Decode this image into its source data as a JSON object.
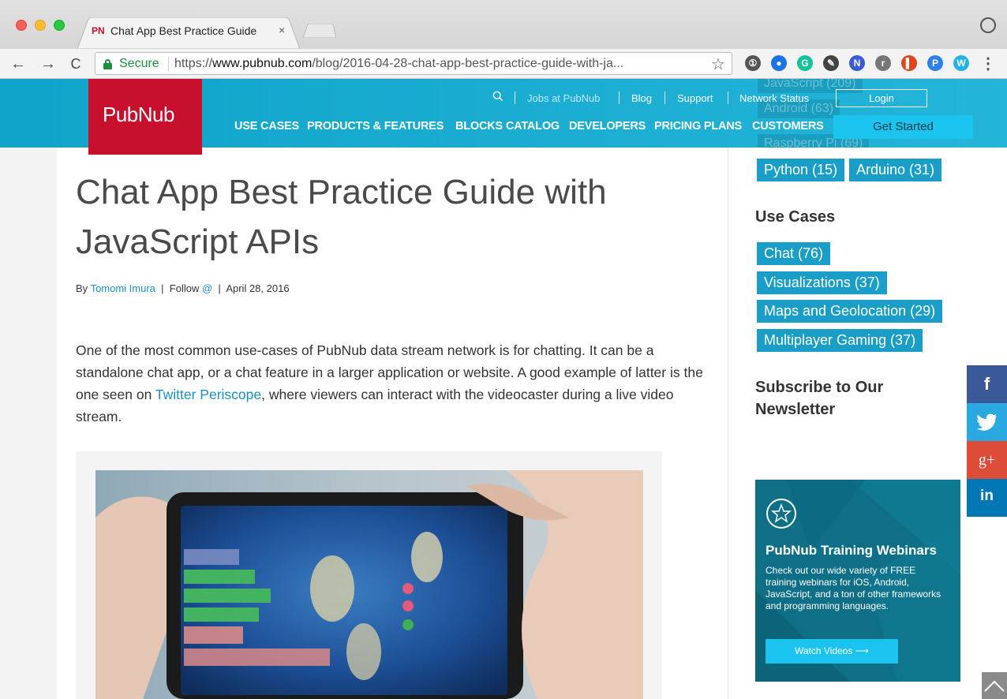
{
  "browser": {
    "tab_favicon": "PN",
    "tab_title": "Chat App Best Practice Guide",
    "tab_close": "×",
    "secure_label": "Secure",
    "url_scheme": "https://",
    "url_host": "www.pubnub.com",
    "url_path": "/blog/2016-04-28-chat-app-best-practice-guide-with-ja...",
    "nav_back": "←",
    "nav_forward": "→",
    "nav_reload": "C",
    "bookmark_star": "☆",
    "menu": "⋮",
    "extensions": [
      {
        "icon": "1password-icon",
        "glyph": "①",
        "color": "#555555"
      },
      {
        "icon": "meet-icon",
        "glyph": "●",
        "color": "#1a73e8"
      },
      {
        "icon": "grammarly-icon",
        "glyph": "G",
        "color": "#15c39a"
      },
      {
        "icon": "pixel-icon",
        "glyph": "✎",
        "color": "#444444"
      },
      {
        "icon": "notion-icon",
        "glyph": "N",
        "color": "#3b5bdb"
      },
      {
        "icon": "r-icon",
        "glyph": "r",
        "color": "#777777"
      },
      {
        "icon": "book-icon",
        "glyph": "▌",
        "color": "#e0441d"
      },
      {
        "icon": "pricetag-icon",
        "glyph": "P",
        "color": "#2f80ed"
      },
      {
        "icon": "w-icon",
        "glyph": "W",
        "color": "#24b3e6"
      }
    ]
  },
  "site": {
    "logo": "PubNub",
    "utility": {
      "jobs": "Jobs at PubNub",
      "blog": "Blog",
      "support": "Support",
      "status": "Network Status",
      "login": "Login"
    },
    "nav": [
      "USE CASES",
      "PRODUCTS & FEATURES",
      "BLOCKS CATALOG",
      "DEVELOPERS",
      "PRICING PLANS",
      "CUSTOMERS"
    ],
    "cta": "Get Started",
    "ghost_tags": [
      "JavaScript (209)",
      "Android (63)",
      "Raspberry Pi (69)"
    ]
  },
  "article": {
    "title": "Chat App Best Practice Guide with JavaScript APIs",
    "by": "By",
    "author": "Tomomi Imura",
    "follow": "Follow",
    "follow_handle": "@",
    "date": "April 28, 2016",
    "divider": "|",
    "para_1": "One of the most common use-cases of PubNub data stream network is for chatting. It can be a standalone chat app, or a chat feature in a larger application or website. A good example of latter is the one seen on ",
    "para_link": "Twitter Periscope",
    "para_2": ", where viewers can interact with the videocaster during a live video stream."
  },
  "sidebar": {
    "lang_tags": [
      "Python (15)",
      "Arduino (31)"
    ],
    "use_cases_heading": "Use Cases",
    "use_cases": [
      "Chat (76)",
      "Visualizations (37)",
      "Maps and Geolocation (29)",
      "Multiplayer Gaming (37)"
    ],
    "newsletter_heading": "Subscribe to Our Newsletter",
    "webinar": {
      "title": "PubNub Training Webinars",
      "body": "Check out our wide variety of FREE training webinars for iOS, Android, JavaScript, and a ton of other frameworks and programming languages.",
      "button": "Watch Videos ⟶"
    }
  },
  "social": {
    "facebook": "f",
    "twitter": "🐦",
    "googleplus": "g+",
    "linkedin": "in"
  },
  "colors": {
    "header": "#1ea9cf",
    "brand_red": "#c8102e",
    "tag": "#1a9ec7",
    "link": "#1a8fc1"
  }
}
